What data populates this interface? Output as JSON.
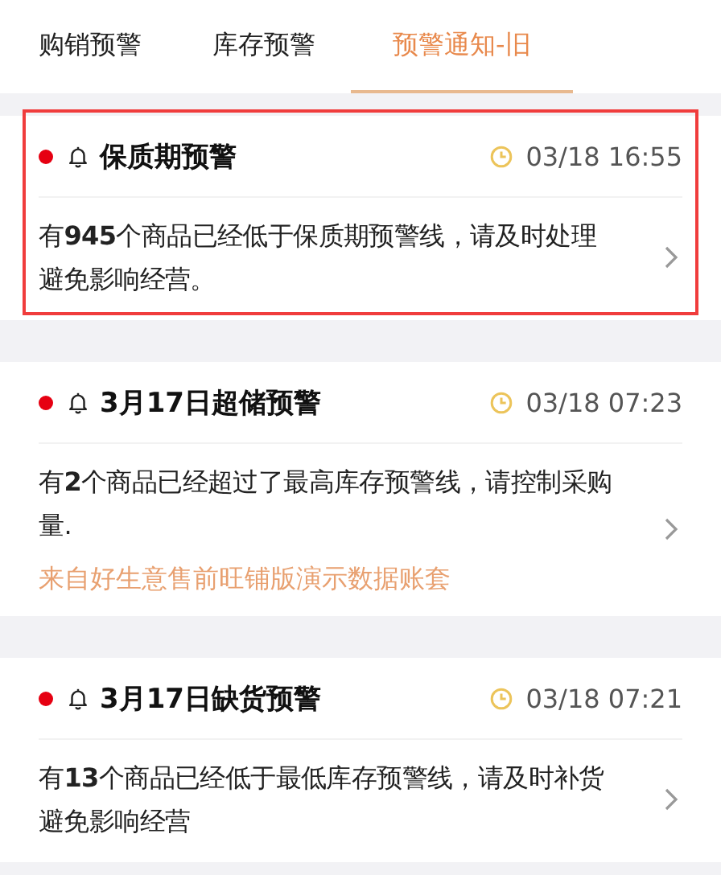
{
  "tabs": [
    {
      "label": "购销预警",
      "selected": false
    },
    {
      "label": "库存预警",
      "selected": false
    },
    {
      "label": "预警通知-旧",
      "selected": true
    }
  ],
  "alerts": [
    {
      "title": "保质期预警",
      "unread": true,
      "time": "03/18 16:55",
      "message": "有**945**个商品已经低于保质期预警线，请及时处理避免影响经营。",
      "highlighted": true
    },
    {
      "title": "3月17日超储预警",
      "unread": true,
      "time": "03/18 07:23",
      "message": "有**2**个商品已经超过了最高库存预警线，请控制采购量.",
      "source": "来自好生意售前旺铺版演示数据账套",
      "highlighted": false
    },
    {
      "title": "3月17日缺货预警",
      "unread": true,
      "time": "03/18 07:21",
      "message": "有**13**个商品已经低于最低库存预警线，请及时补货避免影响经营",
      "highlighted": false
    }
  ]
}
